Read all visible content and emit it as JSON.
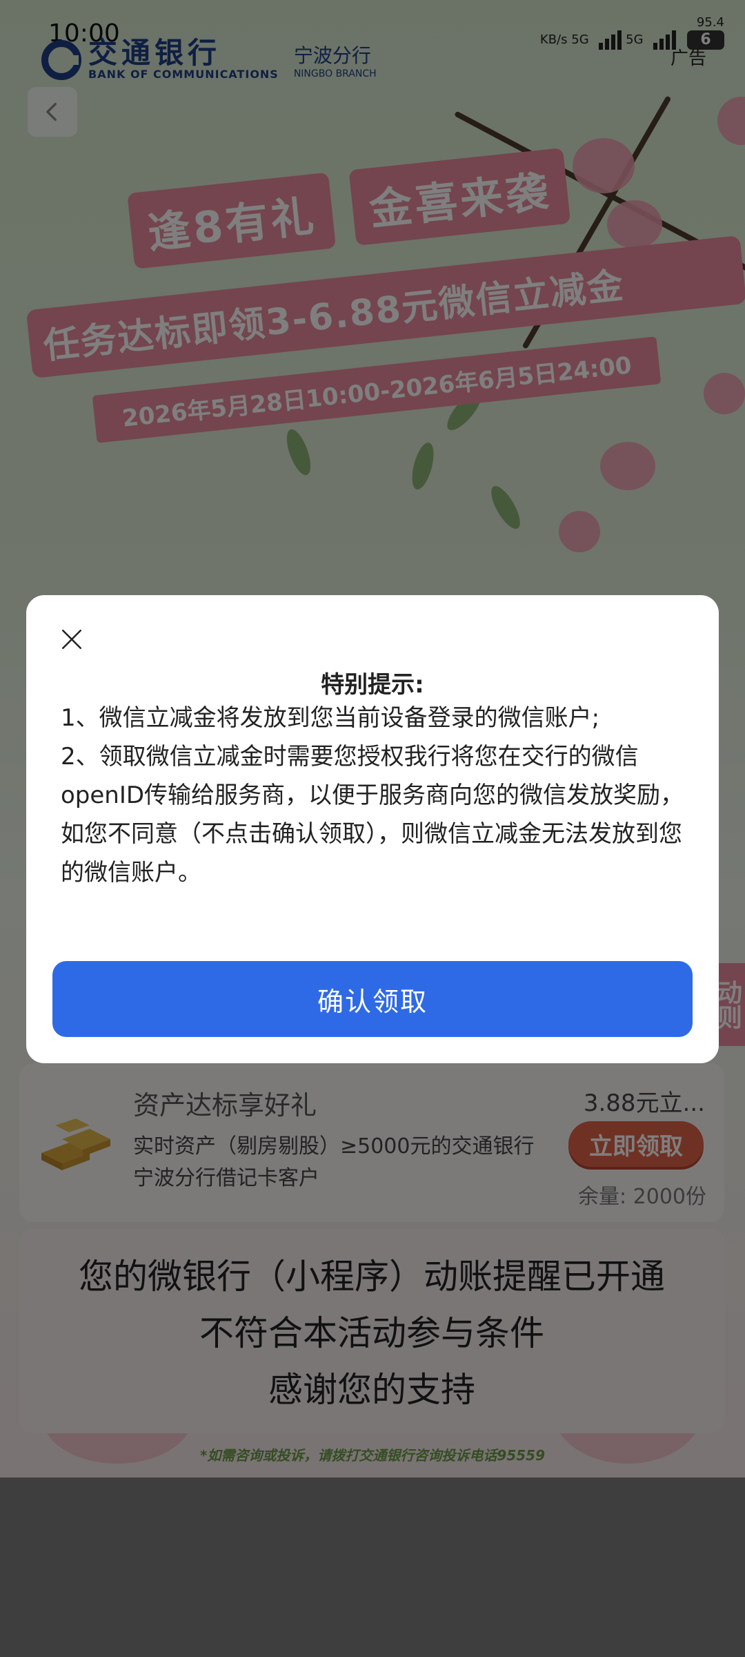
{
  "status_bar": {
    "time": "10:00",
    "speed": "95.4",
    "speed_unit": "KB/s",
    "net1": "5G",
    "net2": "5G",
    "battery": "6"
  },
  "ad_label": "广告",
  "brand": {
    "name_cn": "交通银行",
    "name_en": "BANK OF COMMUNICATIONS",
    "branch_cn": "宁波分行",
    "branch_en": "NINGBO BRANCH",
    "color": "#1e3f86"
  },
  "banner": {
    "title_left": "逢8有礼",
    "title_right": "金喜来袭",
    "subtitle": "任务达标即领3-6.88元微信立减金",
    "date_range": "2026年5月28日10:00-2026年6月5日24:00"
  },
  "side_badge": "动则",
  "task": {
    "title": "资产达标享好礼",
    "description": "实时资产（剔房剔股）≥5000元的交通银行宁波分行借记卡客户",
    "reward": "3.88元立...",
    "claim_label": "立即领取",
    "remaining": "余量: 2000份"
  },
  "notice": {
    "lines": [
      "您的微银行（小程序）动账提醒已开通",
      "不符合本活动参与条件",
      "感谢您的支持"
    ]
  },
  "footer_note": "*如需咨询或投诉，请拨打交通银行咨询投诉电话95559",
  "dialog": {
    "title": "特别提示:",
    "paragraphs": [
      "1、微信立减金将发放到您当前设备登录的微信账户;",
      "2、领取微信立减金时需要您授权我行将您在交行的微信openID传输给服务商，以便于服务商向您的微信发放奖励，如您不同意（不点击确认领取），则微信立减金无法发放到您的微信账户。"
    ],
    "confirm_label": "确认领取",
    "confirm_color": "#2f6ae6"
  }
}
